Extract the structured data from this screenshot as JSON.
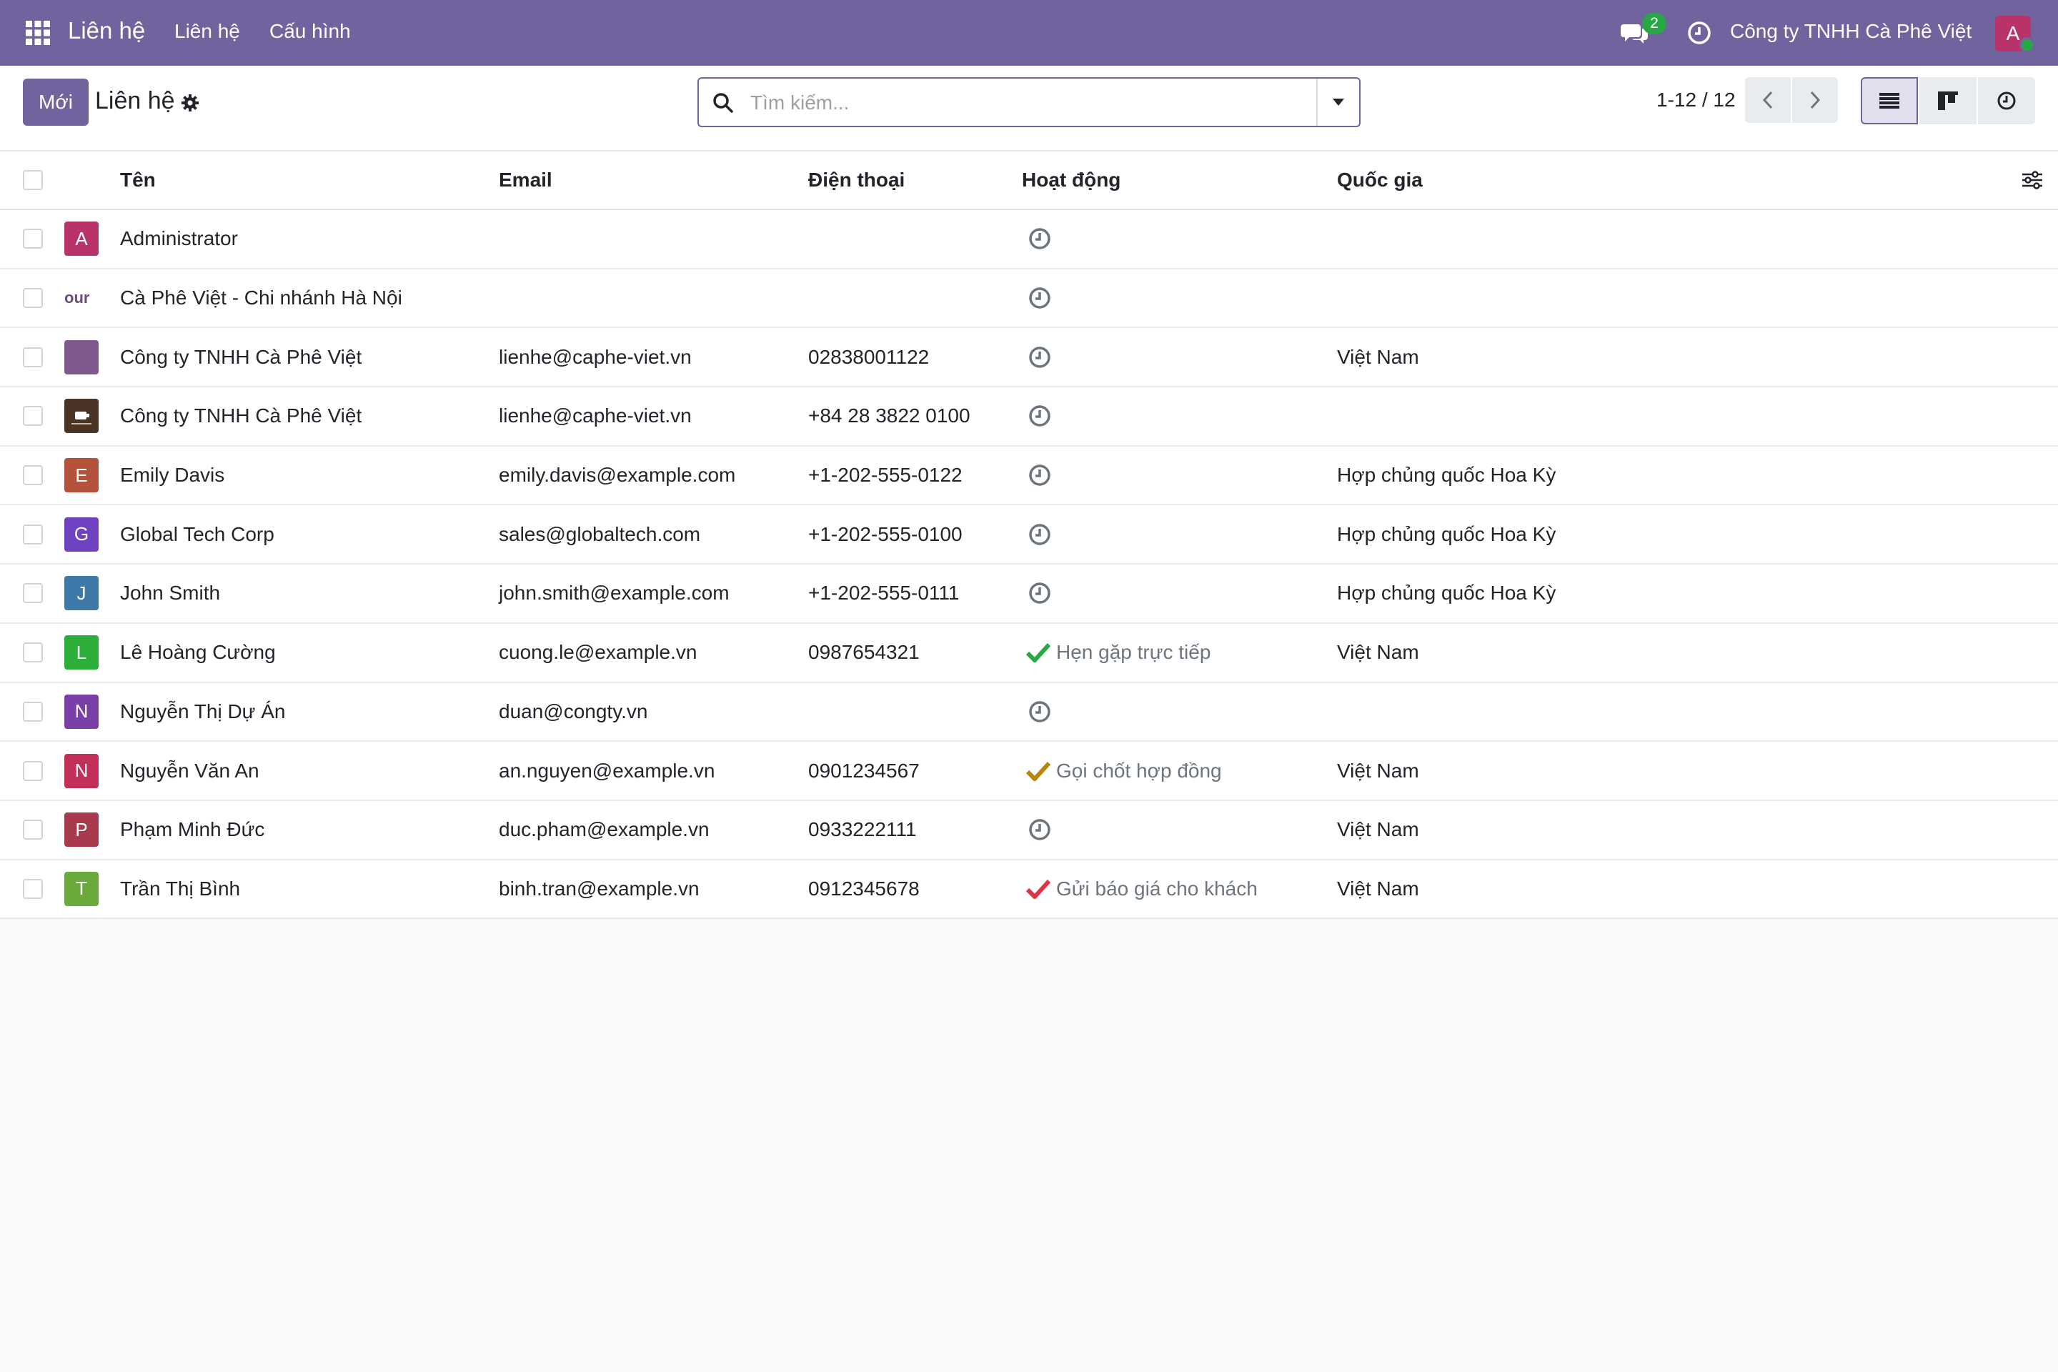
{
  "navbar": {
    "brand": "Liên hệ",
    "menus": [
      "Liên hệ",
      "Cấu hình"
    ],
    "chat_count": "2",
    "company": "Công ty TNHH Cà Phê Việt",
    "user_initial": "A",
    "color": "#71639e"
  },
  "control": {
    "new_label": "Mới",
    "title": "Liên hệ",
    "search_placeholder": "Tìm kiếm...",
    "pager": "1-12 / 12"
  },
  "table": {
    "headers": {
      "name": "Tên",
      "email": "Email",
      "phone": "Điện thoại",
      "activity": "Hoạt động",
      "country": "Quốc gia"
    },
    "rows": [
      {
        "initial": "A",
        "color": "#b8336a",
        "name": "Administrator",
        "email": "",
        "phone": "",
        "activity": "",
        "activity_color": "",
        "country": ""
      },
      {
        "initial": "our",
        "color": "logo-text",
        "name": "Cà Phê Việt - Chi nhánh Hà Nội",
        "email": "",
        "phone": "",
        "activity": "",
        "activity_color": "",
        "country": ""
      },
      {
        "initial": "",
        "color": "#7e5a8c",
        "name": "Công ty TNHH Cà Phê Việt",
        "email": "lienhe@caphe-viet.vn",
        "phone": "02838001122",
        "activity": "",
        "activity_color": "",
        "country": "Việt Nam"
      },
      {
        "initial": "",
        "color": "logo-img",
        "name": "Công ty TNHH Cà Phê Việt",
        "email": "lienhe@caphe-viet.vn",
        "phone": "+84 28 3822 0100",
        "activity": "",
        "activity_color": "",
        "country": ""
      },
      {
        "initial": "E",
        "color": "#b5523b",
        "name": "Emily Davis",
        "email": "emily.davis@example.com",
        "phone": "+1-202-555-0122",
        "activity": "",
        "activity_color": "",
        "country": "Hợp chủng quốc Hoa Kỳ"
      },
      {
        "initial": "G",
        "color": "#6f42c1",
        "name": "Global Tech Corp",
        "email": "sales@globaltech.com",
        "phone": "+1-202-555-0100",
        "activity": "",
        "activity_color": "",
        "country": "Hợp chủng quốc Hoa Kỳ"
      },
      {
        "initial": "J",
        "color": "#3d7aa8",
        "name": "John Smith",
        "email": "john.smith@example.com",
        "phone": "+1-202-555-0111",
        "activity": "",
        "activity_color": "",
        "country": "Hợp chủng quốc Hoa Kỳ"
      },
      {
        "initial": "L",
        "color": "#2bae3a",
        "name": "Lê Hoàng Cường",
        "email": "cuong.le@example.vn",
        "phone": "0987654321",
        "activity": "Hẹn gặp trực tiếp",
        "activity_color": "#28a745",
        "country": "Việt Nam"
      },
      {
        "initial": "N",
        "color": "#7b3fa8",
        "name": "Nguyễn Thị Dự Án",
        "email": "duan@congty.vn",
        "phone": "",
        "activity": "",
        "activity_color": "",
        "country": ""
      },
      {
        "initial": "N",
        "color": "#c2305a",
        "name": "Nguyễn Văn An",
        "email": "an.nguyen@example.vn",
        "phone": "0901234567",
        "activity": "Gọi chốt hợp đồng",
        "activity_color": "#b8860b",
        "country": "Việt Nam"
      },
      {
        "initial": "P",
        "color": "#a83a4e",
        "name": "Phạm Minh Đức",
        "email": "duc.pham@example.vn",
        "phone": "0933222111",
        "activity": "",
        "activity_color": "",
        "country": "Việt Nam"
      },
      {
        "initial": "T",
        "color": "#6aaa3a",
        "name": "Trần Thị Bình",
        "email": "binh.tran@example.vn",
        "phone": "0912345678",
        "activity": "Gửi báo giá cho khách",
        "activity_color": "#dc3545",
        "country": "Việt Nam"
      }
    ]
  }
}
